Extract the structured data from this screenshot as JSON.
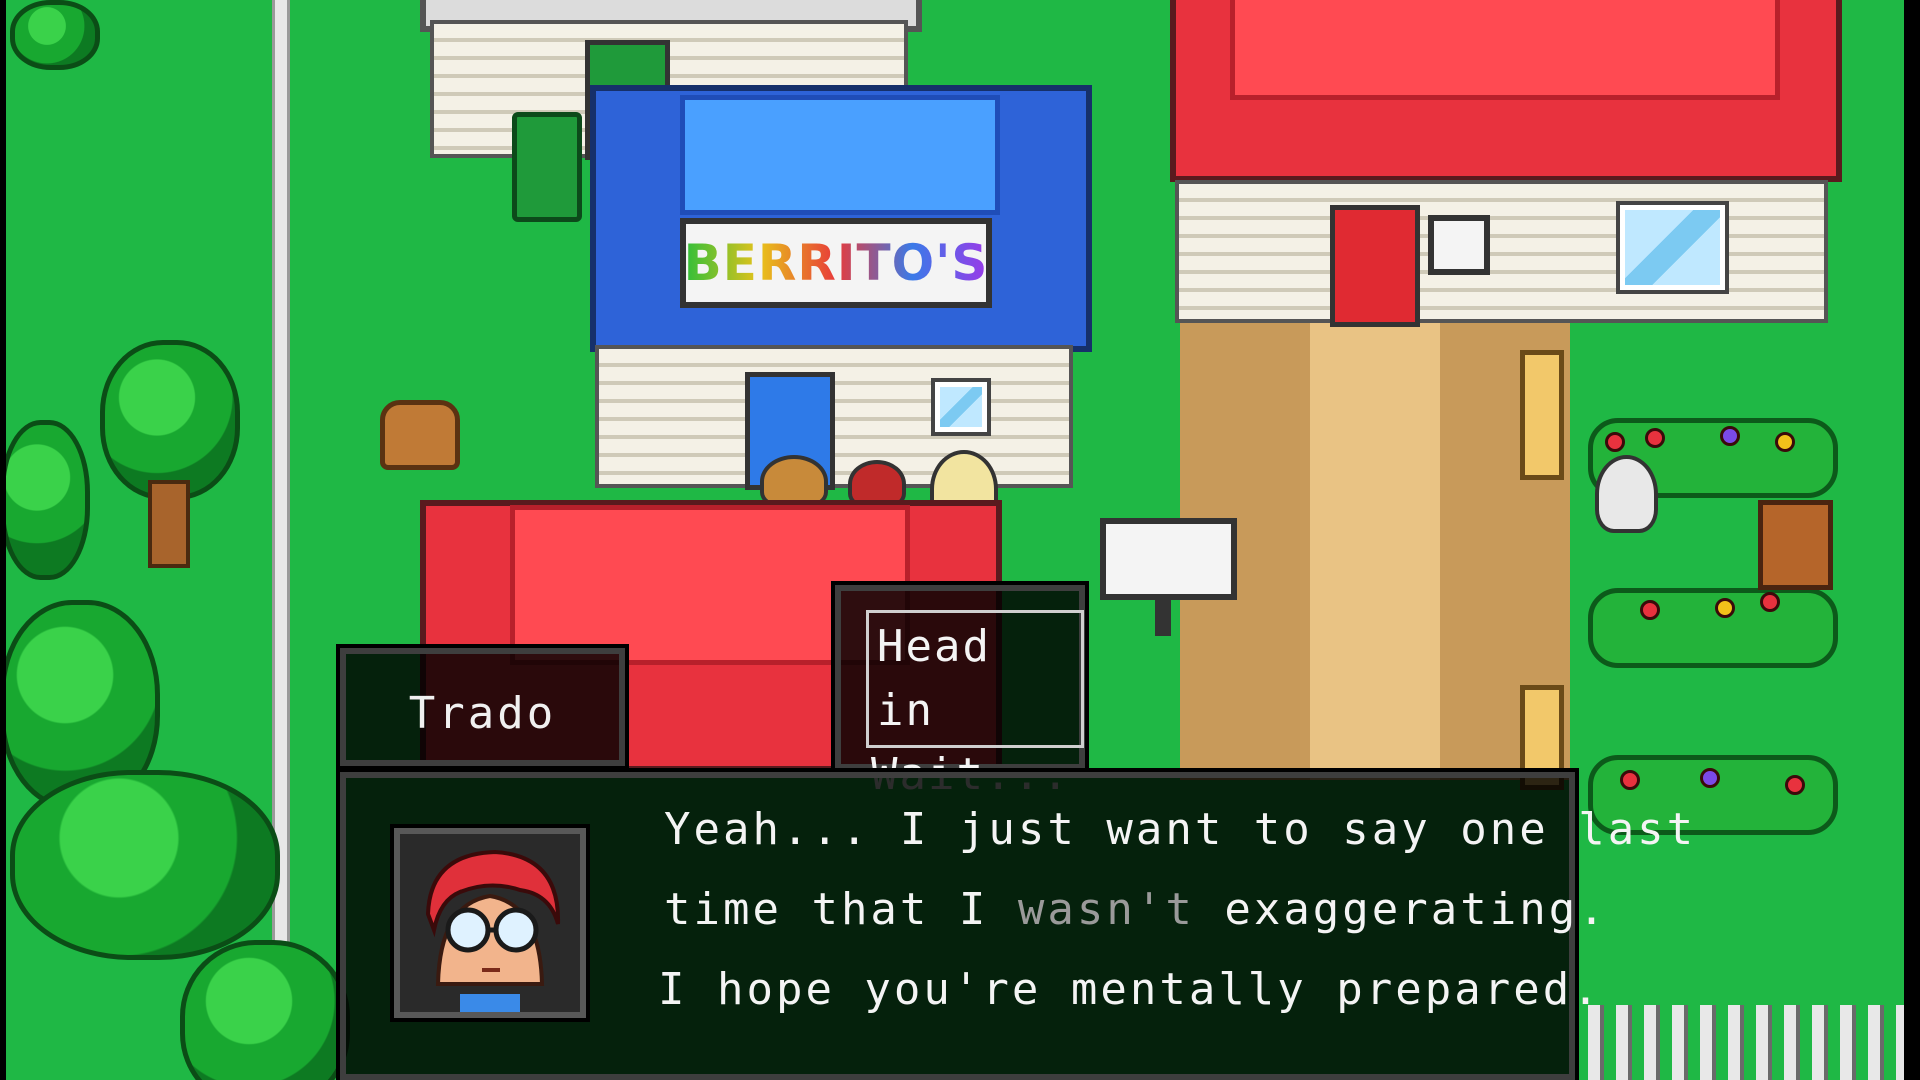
{
  "game": {
    "shop_sign": "BERRITO'S",
    "speaker": {
      "name": "Trado",
      "portrait_icon": "red-haired-glasses-portrait"
    },
    "dialogue": {
      "line1": "Yeah... I just want to say one last",
      "line2_before": "time that I ",
      "line2_dim": "wasn't",
      "line2_after": " exaggerating.",
      "line3": "I hope you're mentally prepared."
    },
    "choices": [
      {
        "label": "Head in",
        "selected": true
      },
      {
        "label": "Wait...",
        "selected": false
      }
    ],
    "colors": {
      "grass": "#1fb845",
      "roof_red": "#e8323e",
      "roof_blue": "#2e63d8",
      "ui_panel": "#000000",
      "ui_text": "#f4f4f4",
      "text_dim": "#9a9a9a"
    }
  }
}
